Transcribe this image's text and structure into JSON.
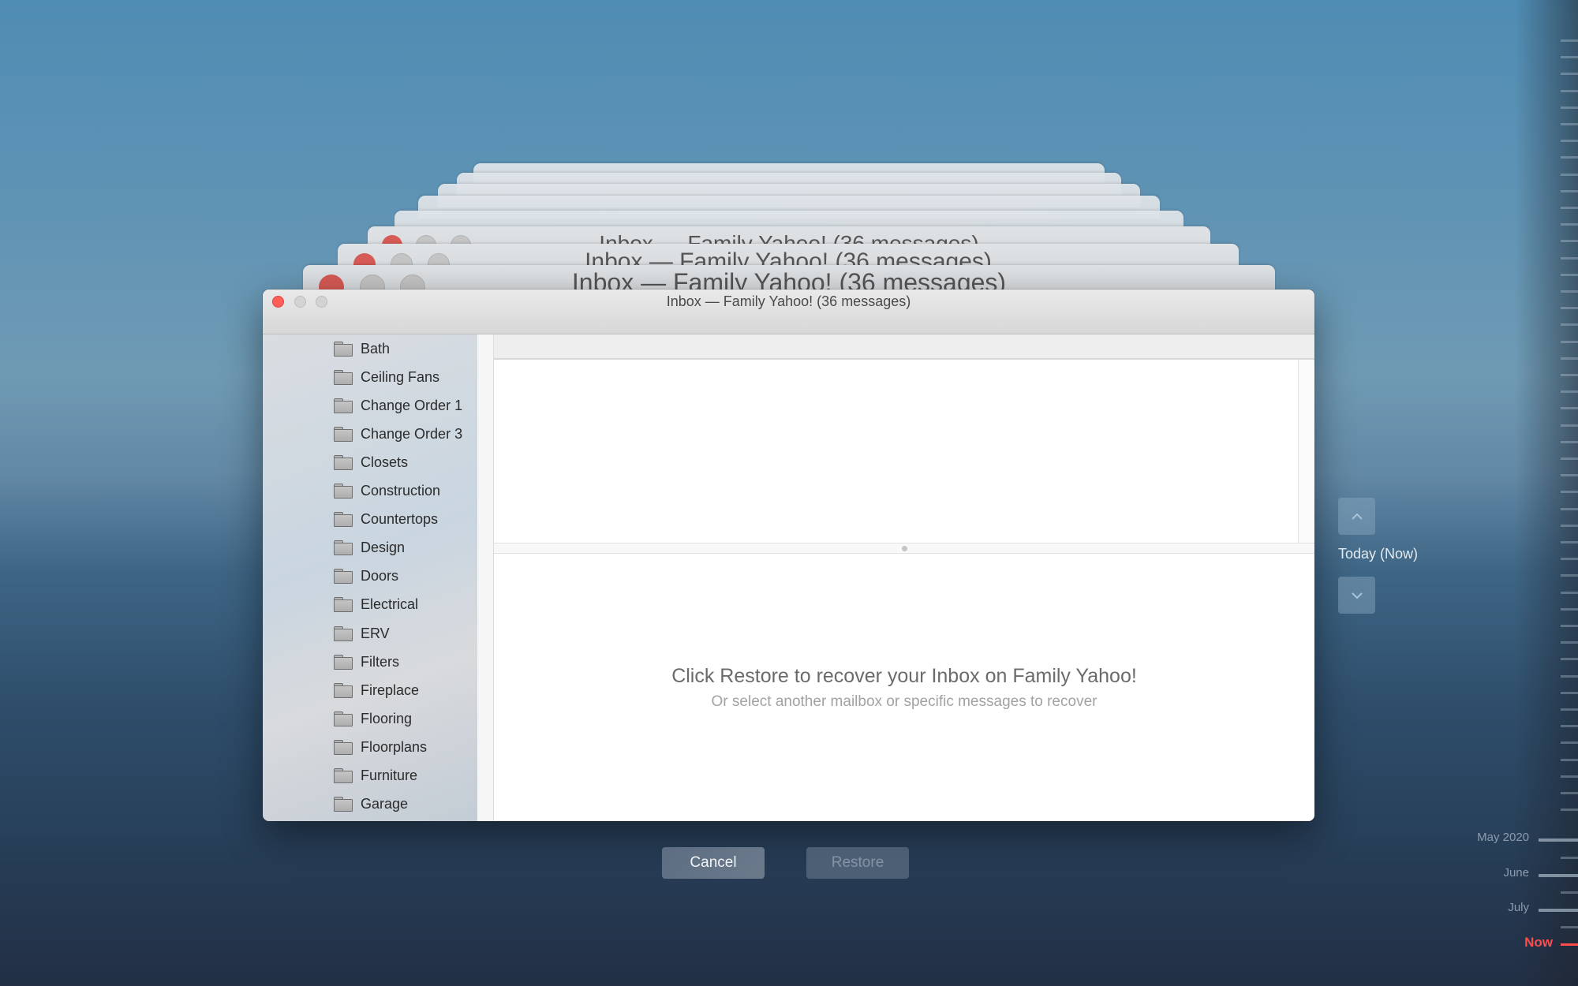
{
  "background_windows": [
    {
      "title": "Inbox — Family Yahoo! (36 messages)",
      "level": 1
    },
    {
      "title": "Inbox — Family Yahoo! (36 messages)",
      "level": 2
    },
    {
      "title": "Inbox — Family Yahoo! (36 messages)",
      "level": 3
    }
  ],
  "window": {
    "title": "Inbox — Family Yahoo! (36 messages)",
    "controls": {
      "close": "close-button",
      "minimize": "minimize-button",
      "zoom": "zoom-button"
    }
  },
  "sidebar": {
    "folders": [
      {
        "label": "Bath",
        "icon": "folder-icon"
      },
      {
        "label": "Ceiling Fans",
        "icon": "folder-icon"
      },
      {
        "label": "Change Order 1",
        "icon": "folder-icon"
      },
      {
        "label": "Change Order 3",
        "icon": "folder-icon"
      },
      {
        "label": "Closets",
        "icon": "folder-icon"
      },
      {
        "label": "Construction",
        "icon": "folder-icon"
      },
      {
        "label": "Countertops",
        "icon": "folder-icon"
      },
      {
        "label": "Design",
        "icon": "folder-icon"
      },
      {
        "label": "Doors",
        "icon": "folder-icon"
      },
      {
        "label": "Electrical",
        "icon": "folder-icon"
      },
      {
        "label": "ERV",
        "icon": "folder-icon"
      },
      {
        "label": "Filters",
        "icon": "folder-icon"
      },
      {
        "label": "Fireplace",
        "icon": "folder-icon"
      },
      {
        "label": "Flooring",
        "icon": "folder-icon"
      },
      {
        "label": "Floorplans",
        "icon": "folder-icon"
      },
      {
        "label": "Furniture",
        "icon": "folder-icon"
      },
      {
        "label": "Garage",
        "icon": "folder-icon"
      }
    ]
  },
  "preview": {
    "message": "Click Restore to recover your Inbox on Family Yahoo!",
    "submessage": "Or select another mailbox or specific messages to recover"
  },
  "buttons": {
    "cancel": "Cancel",
    "restore": "Restore",
    "restore_enabled": false
  },
  "timeline": {
    "up_icon": "chevron-up-icon",
    "down_icon": "chevron-down-icon",
    "current_label": "Today (Now)",
    "markers": [
      {
        "label": "May 2020",
        "type": "major"
      },
      {
        "label": "June",
        "type": "major"
      },
      {
        "label": "July",
        "type": "major"
      },
      {
        "label": "Now",
        "type": "now"
      }
    ]
  },
  "colors": {
    "close_red": "#fe5f57",
    "now_red": "#ff4d4d"
  }
}
